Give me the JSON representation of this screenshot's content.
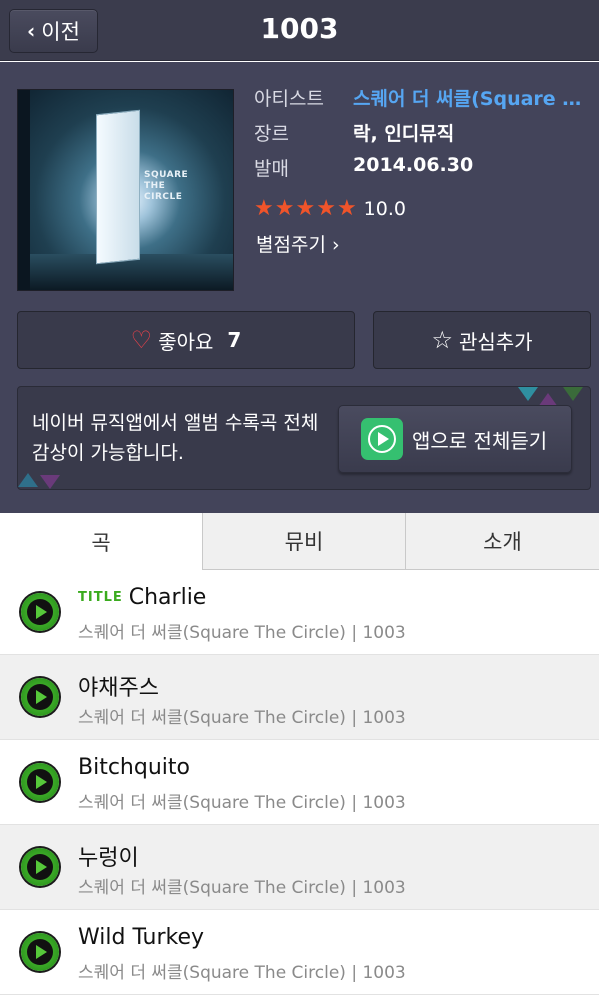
{
  "header": {
    "back_label": "이전",
    "title": "1003"
  },
  "album": {
    "cover_text": "SQUARE THE CIRCLE",
    "artist_label": "아티스트",
    "artist_value": "스퀘어 더 써클(Square The Circle)",
    "genre_label": "장르",
    "genre_value": "락, 인디뮤직",
    "release_label": "발매",
    "release_value": "2014.06.30",
    "rating_stars": 5,
    "rating_value": "10.0",
    "rate_link": "별점주기 ›"
  },
  "actions": {
    "like_label": "좋아요",
    "like_count": "7",
    "fav_label": "관심추가"
  },
  "banner": {
    "text": "네이버 뮤직앱에서 앨범 수록곡 전체 감상이 가능합니다.",
    "button_label": "앱으로 전체듣기"
  },
  "tabs": [
    "곡",
    "뮤비",
    "소개"
  ],
  "tracks": [
    {
      "badge": "TITLE",
      "name": "Charlie",
      "sub": "스퀘어 더 써클(Square The Circle) | 1003"
    },
    {
      "badge": "",
      "name": "야채주스",
      "sub": "스퀘어 더 써클(Square The Circle) | 1003"
    },
    {
      "badge": "",
      "name": "Bitchquito",
      "sub": "스퀘어 더 써클(Square The Circle) | 1003"
    },
    {
      "badge": "",
      "name": "누렁이",
      "sub": "스퀘어 더 써클(Square The Circle) | 1003"
    },
    {
      "badge": "",
      "name": "Wild Turkey",
      "sub": "스퀘어 더 써클(Square The Circle) | 1003"
    }
  ],
  "colors": {
    "header_bg": "#3b3c4d",
    "panel_bg": "#43445a",
    "link": "#56a6f2",
    "star": "#f0542a",
    "title_badge": "#3aab1e",
    "play_green": "#56c93a",
    "heart": "#e8424a"
  }
}
